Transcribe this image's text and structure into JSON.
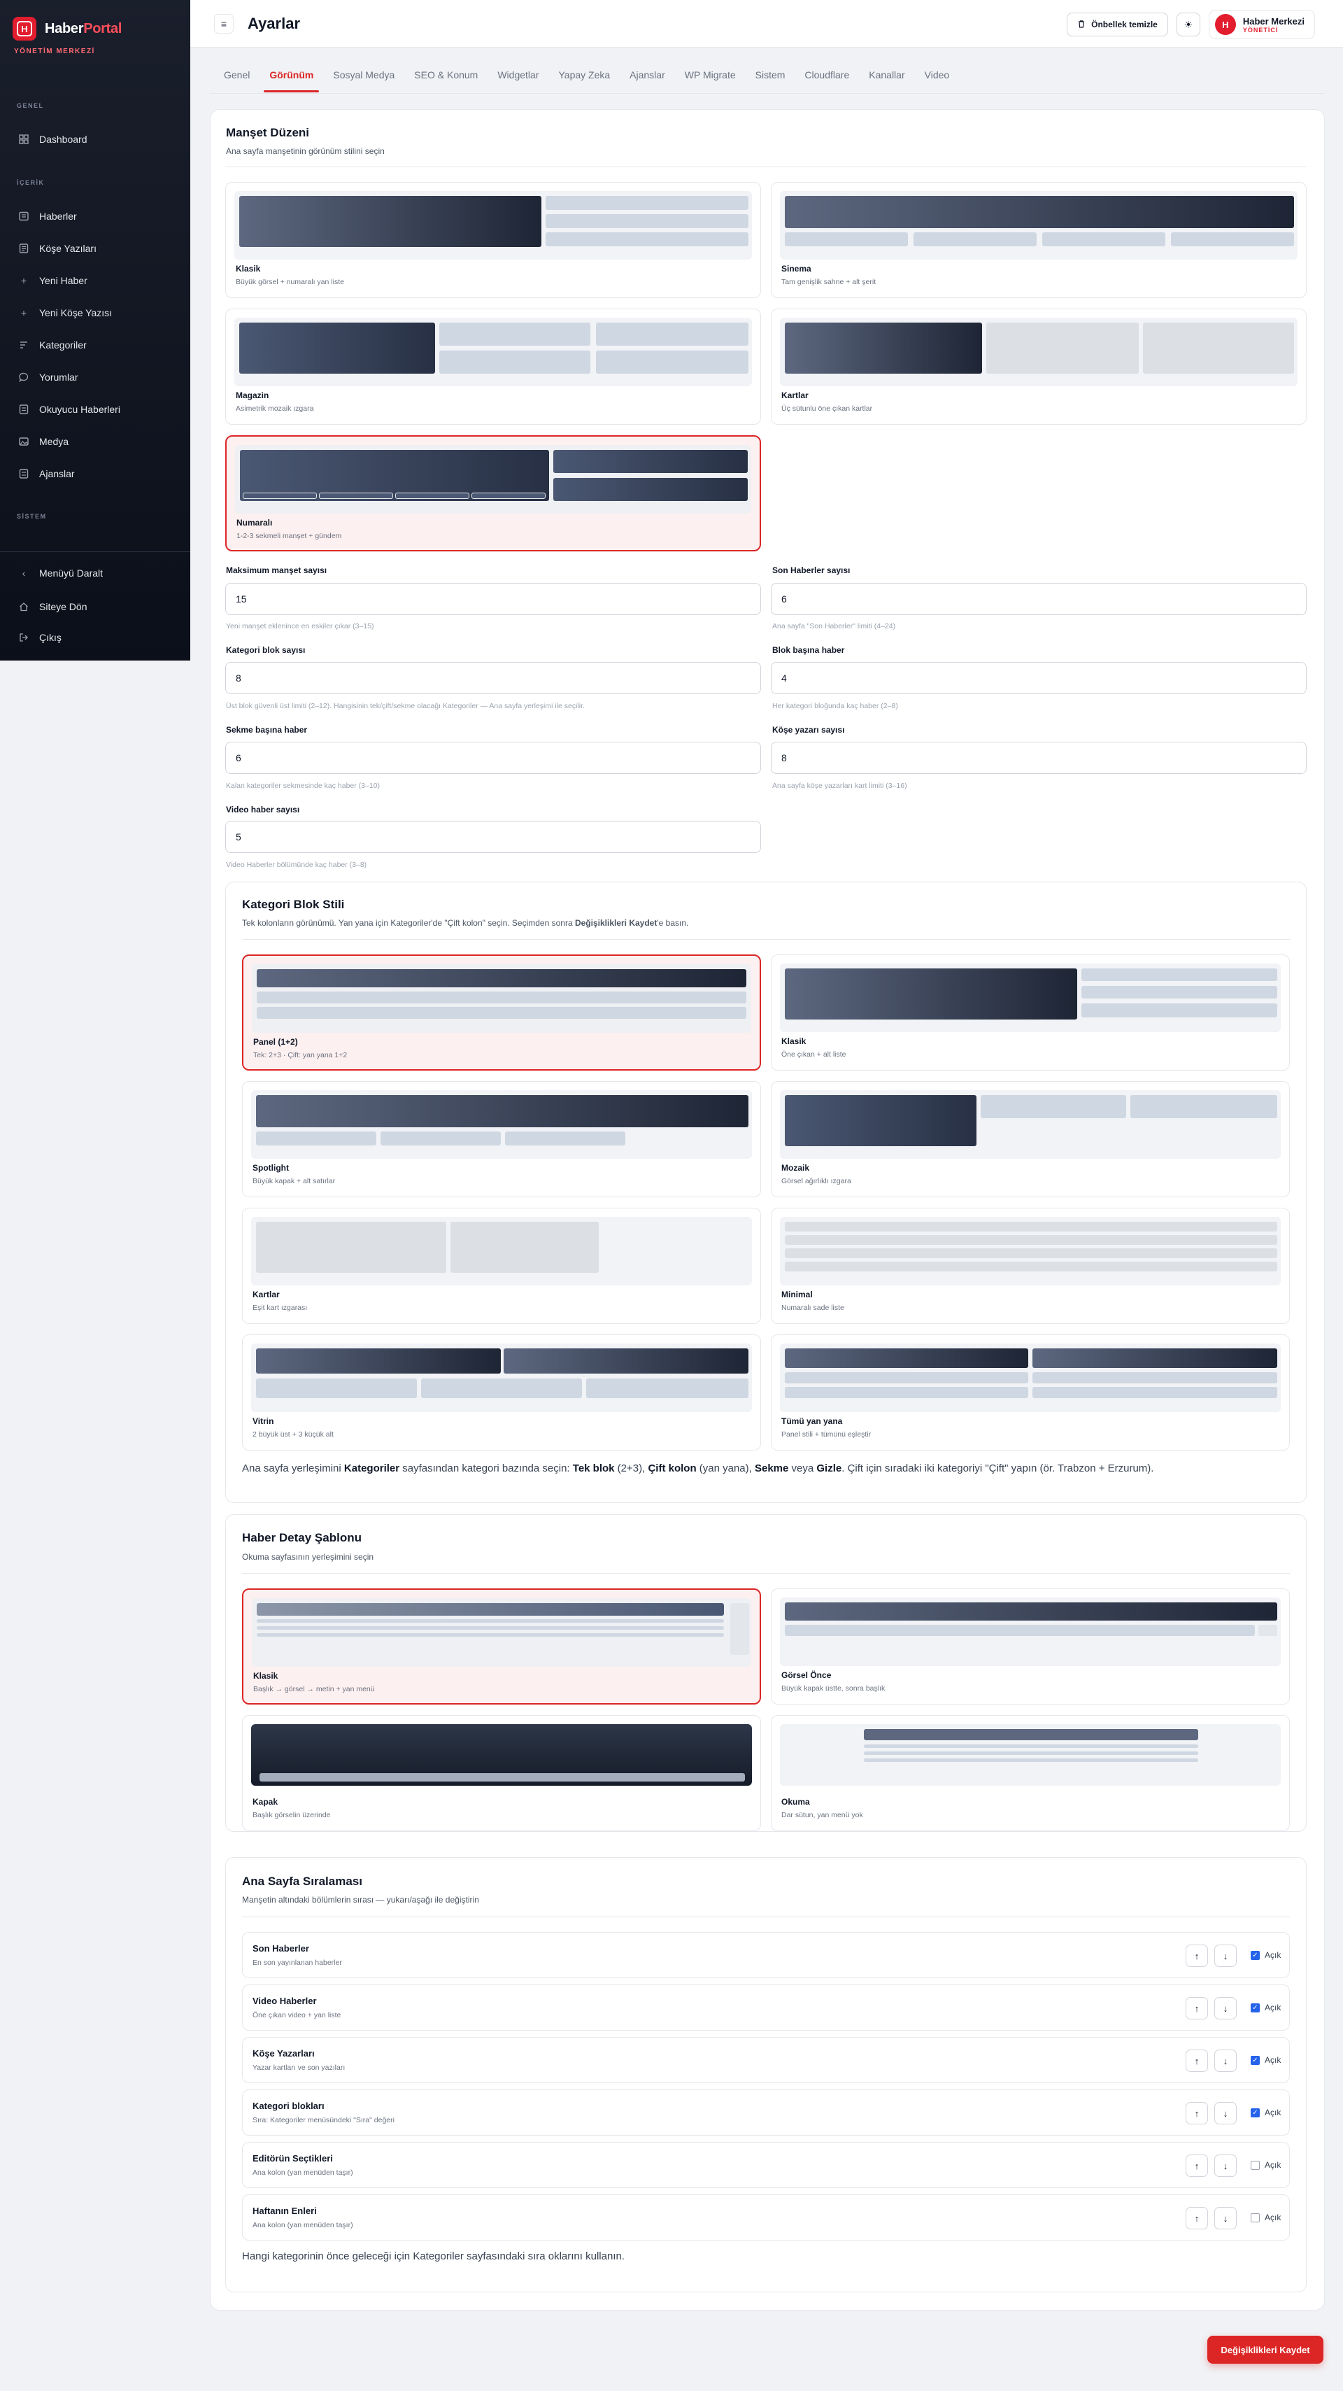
{
  "app": {
    "brand_prefix": "Haber",
    "brand_suffix": "Portal",
    "brand_sub": "YÖNETİM MERKEZİ"
  },
  "sidebar": {
    "sections": [
      "GENEL",
      "İÇERİK",
      "SİSTEM"
    ],
    "items": [
      {
        "label": "Dashboard",
        "icon": "dashboard-icon"
      },
      {
        "label": "Haberler",
        "icon": "news-icon"
      },
      {
        "label": "Köşe Yazıları",
        "icon": "column-icon"
      },
      {
        "label": "Yeni Haber",
        "icon": "plus-icon"
      },
      {
        "label": "Yeni Köşe Yazısı",
        "icon": "plus-icon"
      },
      {
        "label": "Kategoriler",
        "icon": "categories-icon"
      },
      {
        "label": "Yorumlar",
        "icon": "comment-icon"
      },
      {
        "label": "Okuyucu Haberleri",
        "icon": "reader-news-icon"
      },
      {
        "label": "Medya",
        "icon": "media-icon"
      },
      {
        "label": "Ajanslar",
        "icon": "agency-icon"
      }
    ],
    "bottom": [
      {
        "label": "Menüyü Daralt",
        "icon": "chevron-left-icon"
      },
      {
        "label": "Siteye Dön",
        "icon": "home-icon"
      },
      {
        "label": "Çıkış",
        "icon": "logout-icon"
      }
    ]
  },
  "topbar": {
    "title": "Ayarlar",
    "cache_label": "Önbellek temizle",
    "user_initial": "H",
    "user_name": "Haber Merkezi",
    "user_role": "YÖNETİCİ"
  },
  "tabs": [
    "Genel",
    "Görünüm",
    "Sosyal Medya",
    "SEO & Konum",
    "Widgetlar",
    "Yapay Zeka",
    "Ajanslar",
    "WP Migrate",
    "Sistem",
    "Cloudflare",
    "Kanallar",
    "Video"
  ],
  "active_tab": "Görünüm",
  "manset": {
    "title": "Manşet Düzeni",
    "desc": "Ana sayfa manşetinin görünüm stilini seçin",
    "options": [
      {
        "name": "Klasik",
        "desc": "Büyük görsel + numaralı yan liste"
      },
      {
        "name": "Sinema",
        "desc": "Tam genişlik sahne + alt şerit"
      },
      {
        "name": "Magazin",
        "desc": "Asimetrik mozaik ızgara"
      },
      {
        "name": "Kartlar",
        "desc": "Üç sütunlu öne çıkan kartlar"
      },
      {
        "name": "Numaralı",
        "desc": "1-2-3 sekmeli manşet + gündem"
      }
    ],
    "selected": "Numaralı"
  },
  "fields": [
    {
      "label": "Maksimum manşet sayısı",
      "value": "15",
      "help": "Yeni manşet eklenince en eskiler çıkar (3–15)"
    },
    {
      "label": "Son Haberler sayısı",
      "value": "6",
      "help": "Ana sayfa \"Son Haberler\" limiti (4–24)"
    },
    {
      "label": "Kategori blok sayısı",
      "value": "8",
      "help": "Üst blok güvenli üst limiti (2–12). Hangisinin tek/çift/sekme olacağı Kategoriler — Ana sayfa yerleşimi ile seçilir."
    },
    {
      "label": "Blok başına haber",
      "value": "4",
      "help": "Her kategori bloğunda kaç haber (2–8)"
    },
    {
      "label": "Sekme başına haber",
      "value": "6",
      "help": "Kalan kategoriler sekmesinde kaç haber (3–10)"
    },
    {
      "label": "Köşe yazarı sayısı",
      "value": "8",
      "help": "Ana sayfa köşe yazarları kart limiti (3–16)"
    },
    {
      "label": "Video haber sayısı",
      "value": "5",
      "help": "Video Haberler bölümünde kaç haber (3–8)"
    }
  ],
  "kategori": {
    "title": "Kategori Blok Stili",
    "desc_a": "Tek kolonların görünümü. Yan yana için Kategoriler'de \"Çift kolon\" seçin. Seçimden sonra ",
    "desc_b": "Değişiklikleri Kaydet",
    "desc_c": "'e basın.",
    "options": [
      {
        "name": "Panel (1+2)",
        "desc": "Tek: 2+3 · Çift: yan yana 1+2"
      },
      {
        "name": "Klasik",
        "desc": "Öne çıkan + alt liste"
      },
      {
        "name": "Spotlight",
        "desc": "Büyük kapak + alt satırlar"
      },
      {
        "name": "Mozaik",
        "desc": "Görsel ağırlıklı ızgara"
      },
      {
        "name": "Kartlar",
        "desc": "Eşit kart ızgarası"
      },
      {
        "name": "Minimal",
        "desc": "Numaralı sade liste"
      },
      {
        "name": "Vitrin",
        "desc": "2 büyük üst + 3 küçük alt"
      },
      {
        "name": "Tümü yan yana",
        "desc": "Panel stili + tümünü eşleştir"
      }
    ],
    "selected": "Panel (1+2)",
    "note": {
      "t1": "Ana sayfa yerleşimini ",
      "b1": "Kategoriler",
      "t2": " sayfasından kategori bazında seçin: ",
      "b2": "Tek blok",
      "t3": " (2+3), ",
      "b3": "Çift kolon",
      "t4": " (yan yana), ",
      "b4": "Sekme",
      "t5": " veya ",
      "b5": "Gizle",
      "t6": ". Çift için sıradaki iki kategoriyi \"Çift\" yapın (ör. Trabzon + Erzurum)."
    }
  },
  "detay": {
    "title": "Haber Detay Şablonu",
    "desc": "Okuma sayfasının yerleşimini seçin",
    "options": [
      {
        "name": "Klasik",
        "desc": "Başlık → görsel → metin + yan menü"
      },
      {
        "name": "Görsel Önce",
        "desc": "Büyük kapak üstte, sonra başlık"
      },
      {
        "name": "Kapak",
        "desc": "Başlık görselin üzerinde"
      },
      {
        "name": "Okuma",
        "desc": "Dar sütun, yan menü yok"
      }
    ],
    "selected": "Klasik"
  },
  "siralama": {
    "title": "Ana Sayfa Sıralaması",
    "desc": "Manşetin altındaki bölümlerin sırası — yukarı/aşağı ile değiştirin",
    "check_label": "Açık",
    "up": "↑",
    "down": "↓",
    "rows": [
      {
        "title": "Son Haberler",
        "desc": "En son yayınlanan haberler",
        "on": true
      },
      {
        "title": "Video Haberler",
        "desc": "Öne çıkan video + yan liste",
        "on": true
      },
      {
        "title": "Köşe Yazarları",
        "desc": "Yazar kartları ve son yazıları",
        "on": true
      },
      {
        "title": "Kategori blokları",
        "desc": "Sıra: Kategoriler menüsündeki \"Sıra\" değeri",
        "on": true
      },
      {
        "title": "Editörün Seçtikleri",
        "desc": "Ana kolon (yan menüden taşır)",
        "on": false
      },
      {
        "title": "Haftanın Enleri",
        "desc": "Ana kolon (yan menüden taşır)",
        "on": false
      }
    ],
    "note": "Hangi kategorinin önce geleceği için Kategoriler sayfasındaki sıra oklarını kullanın."
  },
  "save_label": "Değişiklikleri Kaydet"
}
